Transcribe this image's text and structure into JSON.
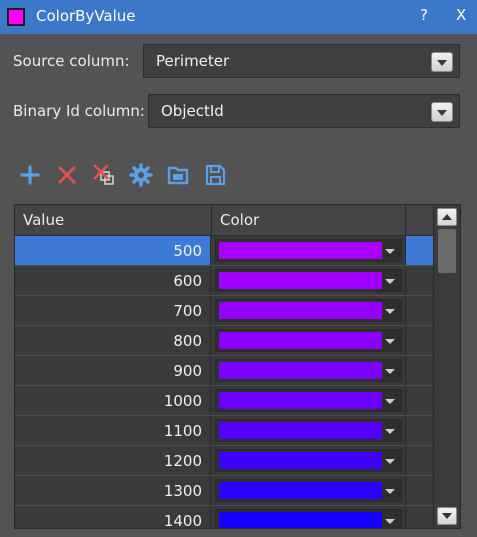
{
  "window": {
    "title": "ColorByValue",
    "help_label": "?",
    "close_label": "X",
    "accent": "#ff00ff"
  },
  "source_column": {
    "label": "Source column:",
    "value": "Perimeter"
  },
  "binary_id_column": {
    "label": "Binary Id column:",
    "value": "ObjectId"
  },
  "toolbar": {
    "icons": [
      "add-icon",
      "delete-icon",
      "delete-all-icon",
      "settings-icon",
      "open-icon",
      "save-icon"
    ]
  },
  "grid": {
    "columns": [
      "Value",
      "Color"
    ],
    "selected_index": 0,
    "rows": [
      {
        "value": "500",
        "color": "#aa00ff"
      },
      {
        "value": "600",
        "color": "#a000ff"
      },
      {
        "value": "700",
        "color": "#9500ff"
      },
      {
        "value": "800",
        "color": "#8a00ff"
      },
      {
        "value": "900",
        "color": "#7a00ff"
      },
      {
        "value": "1000",
        "color": "#6a00ff"
      },
      {
        "value": "1100",
        "color": "#5500ff"
      },
      {
        "value": "1200",
        "color": "#4000ff"
      },
      {
        "value": "1300",
        "color": "#2a00ff"
      },
      {
        "value": "1400",
        "color": "#1500ff"
      }
    ]
  }
}
